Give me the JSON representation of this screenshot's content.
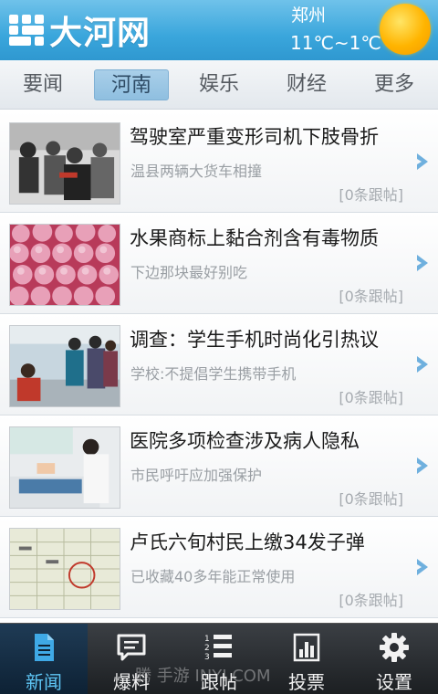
{
  "header": {
    "logo_text": "大河网",
    "city": "郑州",
    "temperature": "11℃~1℃",
    "weather_icon": "sunny-icon"
  },
  "tabs": [
    {
      "label": "要闻",
      "active": false
    },
    {
      "label": "河南",
      "active": true
    },
    {
      "label": "娱乐",
      "active": false
    },
    {
      "label": "财经",
      "active": false
    },
    {
      "label": "更多",
      "active": false
    }
  ],
  "news": [
    {
      "title": "驾驶室严重变形司机下肢骨折",
      "subtitle": "温县两辆大货车相撞",
      "replies": "[0条跟帖]"
    },
    {
      "title": "水果商标上黏合剂含有毒物质",
      "subtitle": "下边那块最好别吃",
      "replies": "[0条跟帖]"
    },
    {
      "title": "调查：学生手机时尚化引热议",
      "subtitle": "学校:不提倡学生携带手机",
      "replies": "[0条跟帖]"
    },
    {
      "title": "医院多项检查涉及病人隐私",
      "subtitle": "市民呼吁应加强保护",
      "replies": "[0条跟帖]"
    },
    {
      "title": "卢氏六旬村民上缴34发子弹",
      "subtitle": "已收藏40多年能正常使用",
      "replies": "[0条跟帖]"
    }
  ],
  "bottom_nav": [
    {
      "label": "新闻",
      "icon": "news-document-icon",
      "active": true
    },
    {
      "label": "爆料",
      "icon": "chat-bubble-icon",
      "active": false
    },
    {
      "label": "跟帖",
      "icon": "numbered-list-icon",
      "active": false
    },
    {
      "label": "投票",
      "icon": "bar-chart-icon",
      "active": false
    },
    {
      "label": "设置",
      "icon": "gear-icon",
      "active": false
    }
  ],
  "watermark": "腾 手游 INYI.COM",
  "colors": {
    "header": "#3aa6dc",
    "active_tab": "#8fbfe0",
    "bottom_bar": "#2a2d31",
    "active_nav_text": "#5ec6f5"
  }
}
